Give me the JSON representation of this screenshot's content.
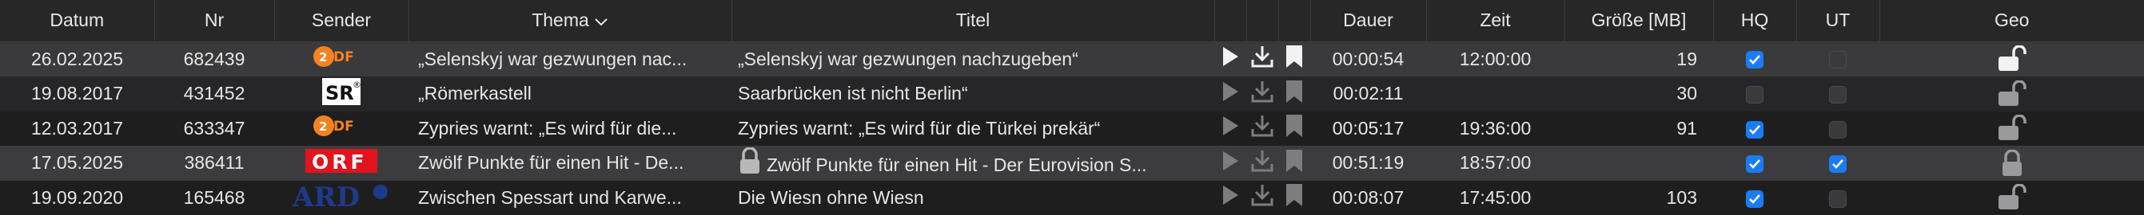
{
  "columns": {
    "datum": "Datum",
    "nr": "Nr",
    "sender": "Sender",
    "thema": "Thema",
    "titel": "Titel",
    "dauer": "Dauer",
    "zeit": "Zeit",
    "groesse": "Größe [MB]",
    "hq": "HQ",
    "ut": "UT",
    "geo": "Geo"
  },
  "sort": {
    "column": "Thema",
    "direction": "descending",
    "icon": "chevron-down-icon"
  },
  "rows": [
    {
      "datum": "26.02.2025",
      "nr": "682439",
      "sender": "ZDF",
      "thema": "„Selenskyj war gezwungen nac...",
      "titel": "„Selenskyj war gezwungen nachzugeben“",
      "dauer": "00:00:54",
      "zeit": "12:00:00",
      "groesse": "19",
      "hq": true,
      "ut": false,
      "geo": "unlocked",
      "actions_enabled": true,
      "title_locked": false,
      "selected": false
    },
    {
      "datum": "19.08.2017",
      "nr": "431452",
      "sender": "SR",
      "thema": "„Römerkastell",
      "titel": "Saarbrücken ist nicht Berlin“",
      "dauer": "00:02:11",
      "zeit": "",
      "groesse": "30",
      "hq": false,
      "ut": false,
      "geo": "unlocked",
      "actions_enabled": false,
      "title_locked": false,
      "selected": false
    },
    {
      "datum": "12.03.2017",
      "nr": "633347",
      "sender": "ZDF",
      "thema": "Zypries warnt: „Es wird für die...",
      "titel": "Zypries warnt: „Es wird für die Türkei prekär“",
      "dauer": "00:05:17",
      "zeit": "19:36:00",
      "groesse": "91",
      "hq": true,
      "ut": false,
      "geo": "unlocked",
      "actions_enabled": false,
      "title_locked": false,
      "selected": false
    },
    {
      "datum": "17.05.2025",
      "nr": "386411",
      "sender": "ORF",
      "thema": "Zwölf Punkte für einen Hit - De...",
      "titel": "Zwölf Punkte für einen Hit - Der Eurovision S...",
      "dauer": "00:51:19",
      "zeit": "18:57:00",
      "groesse": "",
      "hq": true,
      "ut": true,
      "geo": "locked",
      "actions_enabled": false,
      "title_locked": true,
      "selected": false
    },
    {
      "datum": "19.09.2020",
      "nr": "165468",
      "sender": "ARD",
      "thema": "Zwischen Spessart und Karwe...",
      "titel": "Die Wiesn ohne Wiesn",
      "dauer": "00:08:07",
      "zeit": "17:45:00",
      "groesse": "103",
      "hq": true,
      "ut": false,
      "geo": "unlocked",
      "actions_enabled": false,
      "title_locked": false,
      "selected": false
    }
  ],
  "colors": {
    "zdf_orange": "#f58220",
    "orf_red": "#e1141e",
    "ard_blue": "#1e3a8c",
    "checkbox_blue": "#1a7cf5"
  }
}
